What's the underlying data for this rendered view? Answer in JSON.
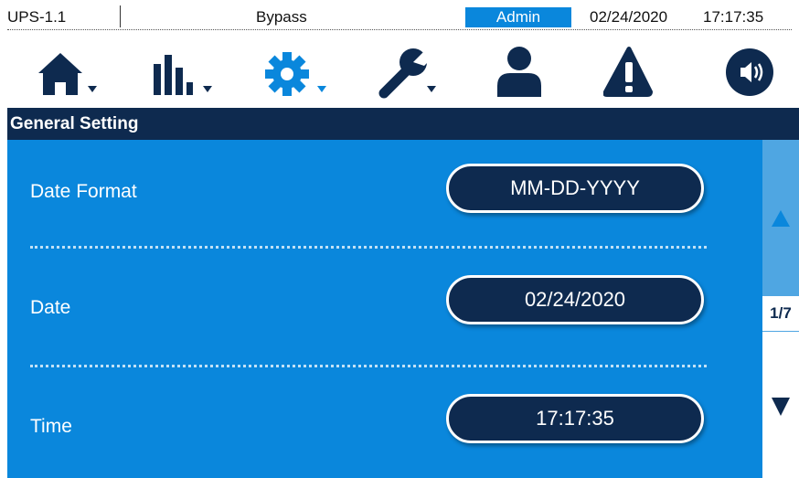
{
  "status_bar": {
    "device": "UPS-1.1",
    "mode": "Bypass",
    "user": "Admin",
    "date": "02/24/2020",
    "time": "17:17:35"
  },
  "toolbar": {
    "icons": [
      "home-icon",
      "measurement-icon",
      "settings-icon",
      "maintenance-icon",
      "user-icon",
      "alarm-icon",
      "sound-icon"
    ]
  },
  "page": {
    "title": "General Setting",
    "indicator": "1/7"
  },
  "settings": [
    {
      "label": "Date Format",
      "value": "MM-DD-YYYY"
    },
    {
      "label": "Date",
      "value": "02/24/2020"
    },
    {
      "label": "Time",
      "value": "17:17:35"
    }
  ],
  "colors": {
    "navy": "#0e2a4f",
    "accent_blue": "#0a87dc",
    "light_blue": "#4fa6e2"
  }
}
